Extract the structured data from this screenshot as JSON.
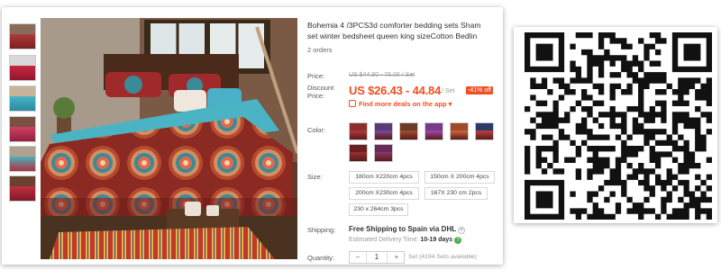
{
  "product": {
    "title_line1": "Bohemia 4 /3PCS3d comforter bedding sets Sham",
    "title_line2": "set winter bedsheet queen king sizeCotton Bedlin",
    "orders": "2 orders"
  },
  "price": {
    "label": "Price:",
    "original": "US $44.80 - 76.00 / Set",
    "discount_label_1": "Discount",
    "discount_label_2": "Price:",
    "current": "US $26.43 - 44.84",
    "unit": "/ Set",
    "off_badge": "-41% off",
    "deals_link": "Find more deals on the app",
    "deals_arrow": "▾"
  },
  "color": {
    "label": "Color:",
    "swatches": [
      {
        "name": "red-mandala",
        "top": "#8b2f2f",
        "bed": "#b23a3a"
      },
      {
        "name": "purple-mandala",
        "top": "#5b3a7a",
        "bed": "#7a4aa0"
      },
      {
        "name": "brown-mandala",
        "top": "#6b3a2a",
        "bed": "#a0522d"
      },
      {
        "name": "violet-mandala",
        "top": "#7a3a8a",
        "bed": "#9b4ab0"
      },
      {
        "name": "orange-mandala",
        "top": "#a04a2a",
        "bed": "#d06a3a"
      },
      {
        "name": "navy-mandala",
        "top": "#2a3a6a",
        "bed": "#c04040"
      },
      {
        "name": "dark-red-mandala",
        "top": "#6a2020",
        "bed": "#9a3030"
      },
      {
        "name": "plum-mandala",
        "top": "#6a2a5a",
        "bed": "#8a3a70"
      }
    ]
  },
  "size": {
    "label": "Size:",
    "options": [
      "180cm X220cm 4pcs",
      "150cm X 200cm 4pcs",
      "200cm X230cm 4pcs",
      "167X 230 cm 2pcs",
      "230 x 264cm 3pcs"
    ]
  },
  "shipping": {
    "label": "Shipping:",
    "free": "Free Shipping to Spain via DHL",
    "est_prefix": "Estimated Delivery Time:",
    "est_days": "10-19 days"
  },
  "quantity": {
    "label": "Quantity:",
    "minus": "−",
    "value": "1",
    "plus": "+",
    "available": "Set (4194 Sets available)"
  },
  "colors": {
    "accent": "#f04e23",
    "green": "#4caf50"
  }
}
